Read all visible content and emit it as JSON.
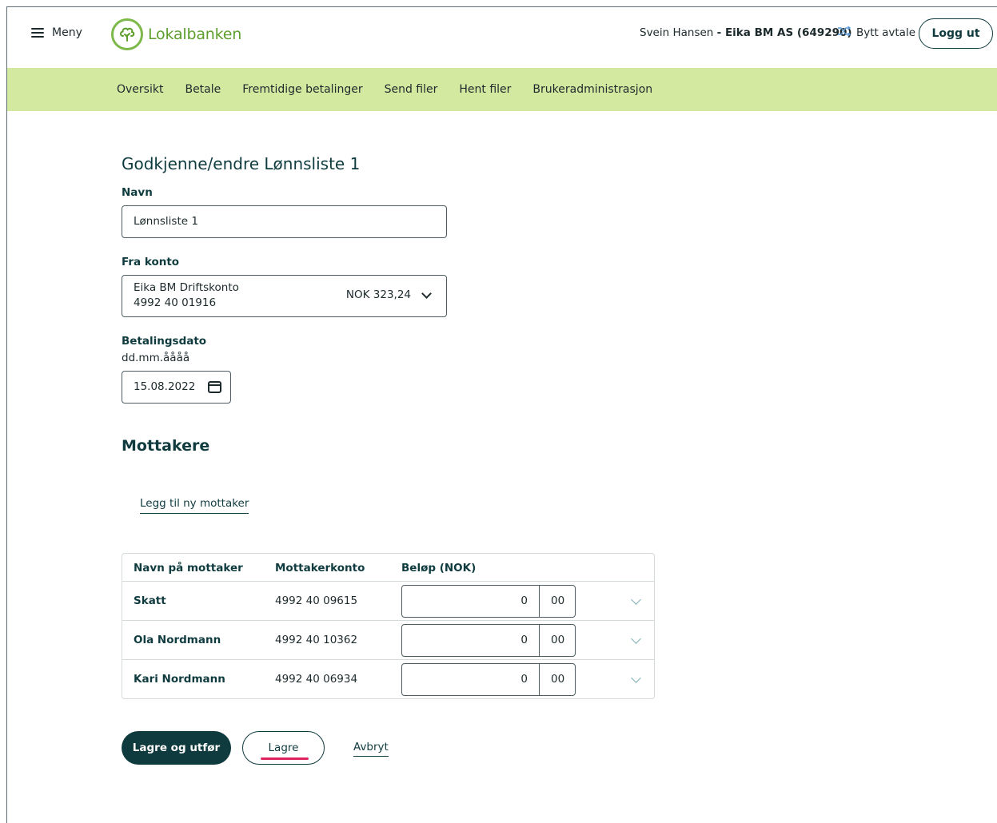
{
  "header": {
    "menu_label": "Meny",
    "logo_text": "Lokalbanken",
    "user_name": "Svein Hansen",
    "user_company": "- Eika BM AS (649290)",
    "switch_label": "Bytt avtale",
    "logout_label": "Logg ut"
  },
  "nav": {
    "items": [
      "Oversikt",
      "Betale",
      "Fremtidige betalinger",
      "Send filer",
      "Hent filer",
      "Brukeradministrasjon"
    ]
  },
  "form": {
    "title": "Godkjenne/endre Lønnsliste 1",
    "name_label": "Navn",
    "name_value": "Lønnsliste 1",
    "from_account_label": "Fra konto",
    "account_name": "Eika BM Driftskonto",
    "account_number": "4992 40 01916",
    "account_balance": "NOK 323,24",
    "date_label": "Betalingsdato",
    "date_format": "dd.mm.åååå",
    "date_value": "15.08.2022"
  },
  "recipients": {
    "title": "Mottakere",
    "add_label": "Legg til ny mottaker",
    "columns": [
      "Navn på mottaker",
      "Mottakerkonto",
      "Beløp (NOK)"
    ],
    "rows": [
      {
        "name": "Skatt",
        "account": "4992 40 09615",
        "kroner": "0",
        "ore": "00"
      },
      {
        "name": "Ola Nordmann",
        "account": "4992 40 10362",
        "kroner": "0",
        "ore": "00"
      },
      {
        "name": "Kari Nordmann",
        "account": "4992 40 06934",
        "kroner": "0",
        "ore": "00"
      }
    ]
  },
  "actions": {
    "save_execute": "Lagre og utfør",
    "save": "Lagre",
    "cancel": "Avbryt"
  },
  "colors": {
    "brand_green": "#5d9e2c",
    "nav_bg": "#d3e9a0",
    "primary_dark": "#0f3b3f",
    "focus_pink": "#e0245e"
  }
}
